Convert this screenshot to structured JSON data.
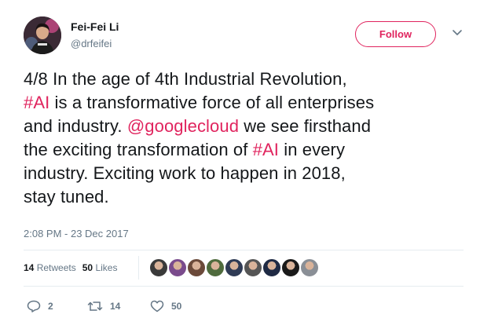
{
  "author": {
    "name": "Fei-Fei Li",
    "handle": "@drfeifei"
  },
  "follow_label": "Follow",
  "tweet_lines": [
    [
      {
        "t": "4/8 In the age of 4th Industrial Revolution,"
      }
    ],
    [
      {
        "t": "#AI",
        "hl": true
      },
      {
        "t": " is a transformative force of all enterprises"
      }
    ],
    [
      {
        "t": "and industry. "
      },
      {
        "t": "@googlecloud",
        "hl": true
      },
      {
        "t": "  we see firsthand"
      }
    ],
    [
      {
        "t": "the exciting transformation of "
      },
      {
        "t": "#AI",
        "hl": true
      },
      {
        "t": " in every"
      }
    ],
    [
      {
        "t": "industry. Exciting work to happen in 2018,"
      }
    ],
    [
      {
        "t": "stay tuned."
      }
    ]
  ],
  "timestamp": "2:08 PM - 23 Dec 2017",
  "stats": {
    "retweets_count": "14",
    "retweets_label": "Retweets",
    "likes_count": "50",
    "likes_label": "Likes"
  },
  "likers": [
    {
      "icon": "liker-avatar-1",
      "color": "#3a3a3a"
    },
    {
      "icon": "liker-avatar-2",
      "color": "#7a4b8c"
    },
    {
      "icon": "liker-avatar-3",
      "color": "#6b4a3a"
    },
    {
      "icon": "liker-avatar-4",
      "color": "#4f6b3d"
    },
    {
      "icon": "liker-avatar-5",
      "color": "#2f3b55"
    },
    {
      "icon": "liker-avatar-6",
      "color": "#555555"
    },
    {
      "icon": "liker-avatar-7",
      "color": "#1f2a44"
    },
    {
      "icon": "liker-avatar-8",
      "color": "#1a1a1a"
    },
    {
      "icon": "liker-avatar-9",
      "color": "#8a8f96"
    }
  ],
  "actions": {
    "replies": "2",
    "retweets": "14",
    "likes": "50"
  },
  "colors": {
    "accent": "#e0245e",
    "text": "#14171a",
    "muted": "#657786"
  }
}
